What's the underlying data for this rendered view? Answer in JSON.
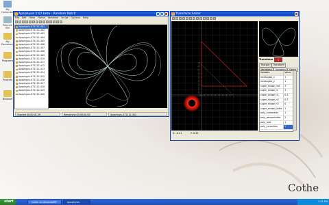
{
  "desktop": {
    "icons": [
      "My Computer",
      "Recycle Bin",
      "My Documents",
      "Programs",
      "Projects",
      "Network"
    ],
    "watermark": "Cothe"
  },
  "apophysis": {
    "title": "Apophysis 2.07 beta - Random Batch",
    "menu": [
      "File",
      "Edit",
      "View",
      "Flame",
      "Variation",
      "Script",
      "Options",
      "Help"
    ],
    "list": [
      "Apophysis-071112-401",
      "Apophysis-071112-402",
      "Apophysis-071112-403",
      "Apophysis-071112-404",
      "Apophysis-071112-405",
      "Apophysis-071112-406",
      "Apophysis-071112-407",
      "Apophysis-071112-408",
      "Apophysis-071112-409",
      "Apophysis-071112-410",
      "Apophysis-071112-411",
      "Apophysis-071112-412",
      "Apophysis-071112-413",
      "Apophysis-071112-414",
      "Apophysis-071112-415",
      "Apophysis-071112-416",
      "Apophysis-071112-417",
      "Apophysis-071112-418",
      "Apophysis-071112-419",
      "Apophysis-071112-420"
    ],
    "status": {
      "elapsed": "Elapsed 00:00:01.39",
      "remaining": "Remaining 00:00:00.00",
      "name": "Apophysis-071112-401"
    }
  },
  "editor": {
    "title": "Transform Editor",
    "coords_x": "X: -0.41",
    "coords_y": "Y: 0.15",
    "transform_label": "Transform",
    "transform_value": "1",
    "tabs": [
      "Triangle",
      "Transform",
      "Variations",
      "Variables",
      "Colors"
    ],
    "vars_header": [
      "Variable",
      "Value"
    ],
    "vars": [
      {
        "name": "rectangles_x",
        "value": "1"
      },
      {
        "name": "rectangles_y",
        "value": "1"
      },
      {
        "name": "super_shape_rnd",
        "value": "3"
      },
      {
        "name": "super_shape_m",
        "value": "3"
      },
      {
        "name": "super_shape_n1",
        "value": "0.3"
      },
      {
        "name": "super_shape_n2",
        "value": "0.3"
      },
      {
        "name": "super_shape_n3",
        "value": "0"
      },
      {
        "name": "super_shape_holes",
        "value": "1"
      },
      {
        "name": "poly_numerator",
        "value": "1"
      },
      {
        "name": "poly_denominator",
        "value": "2"
      },
      {
        "name": "poly_root",
        "value": "1"
      },
      {
        "name": "poly_correction",
        "value": "1"
      }
    ]
  },
  "taskbar": {
    "start": "start",
    "buttons": [
      "Cothe on deviantART",
      "Apophysis"
    ],
    "clock": "1:51 PM"
  },
  "colors": {
    "accent": "#0a3fb8",
    "fractal": "#b9d8c9",
    "grid": "#3a3a3a",
    "triangle": "#c81e1e"
  }
}
